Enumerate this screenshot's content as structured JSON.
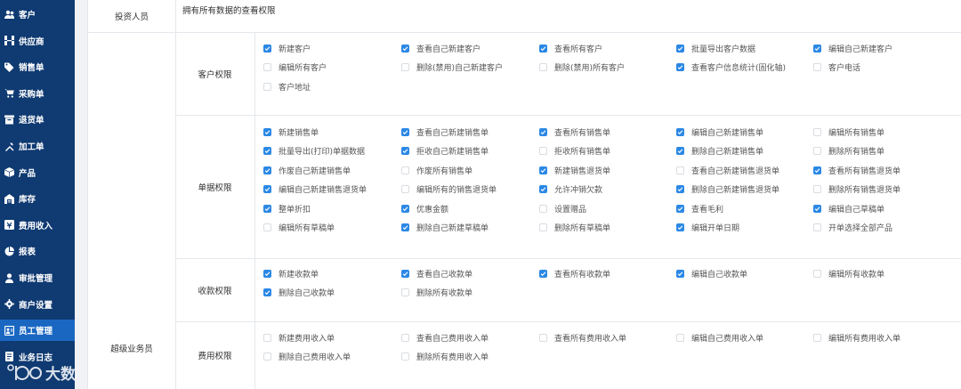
{
  "sidebar": {
    "items": [
      {
        "label": "客户",
        "icon": "users-icon",
        "active": false
      },
      {
        "label": "供应商",
        "icon": "supplier-icon",
        "active": false
      },
      {
        "label": "销售单",
        "icon": "tag-icon",
        "active": false
      },
      {
        "label": "采购单",
        "icon": "cart-icon",
        "active": false
      },
      {
        "label": "退货单",
        "icon": "return-icon",
        "active": false
      },
      {
        "label": "加工单",
        "icon": "tools-icon",
        "active": false
      },
      {
        "label": "产品",
        "icon": "box-icon",
        "active": false
      },
      {
        "label": "库存",
        "icon": "warehouse-icon",
        "active": false
      },
      {
        "label": "费用收入",
        "icon": "money-icon",
        "active": false
      },
      {
        "label": "报表",
        "icon": "chart-icon",
        "active": false
      },
      {
        "label": "审批管理",
        "icon": "approval-icon",
        "active": false
      },
      {
        "label": "商户设置",
        "icon": "gear-icon",
        "active": false
      },
      {
        "label": "员工管理",
        "icon": "staff-icon",
        "active": true
      },
      {
        "label": "业务日志",
        "icon": "log-icon",
        "active": false
      }
    ]
  },
  "watermark": {
    "text": "大数跨境"
  },
  "roles": {
    "investor": {
      "label": "投资人员",
      "description": "拥有所有数据的查看权限"
    },
    "super_staff": {
      "label": "超级业务员"
    }
  },
  "groups": [
    {
      "label": "客户权限",
      "rows": [
        [
          {
            "label": "新建客户",
            "checked": true
          },
          {
            "label": "查看自己新建客户",
            "checked": true
          },
          {
            "label": "查看所有客户",
            "checked": true
          },
          {
            "label": "批量导出客户数据",
            "checked": true
          },
          {
            "label": "编辑自己新建客户",
            "checked": true
          }
        ],
        [
          {
            "label": "编辑所有客户",
            "checked": false
          },
          {
            "label": "删除(禁用)自己新建客户",
            "checked": false
          },
          {
            "label": "删除(禁用)所有客户",
            "checked": false
          },
          {
            "label": "查看客户信息统计(固化轴)",
            "checked": true
          },
          {
            "label": "客户电话",
            "checked": false
          }
        ],
        [
          {
            "label": "客户地址",
            "checked": false
          }
        ]
      ]
    },
    {
      "label": "单据权限",
      "rows": [
        [
          {
            "label": "新建销售单",
            "checked": true
          },
          {
            "label": "查看自己新建销售单",
            "checked": true
          },
          {
            "label": "查看所有销售单",
            "checked": true
          },
          {
            "label": "编辑自己新建销售单",
            "checked": true
          },
          {
            "label": "编辑所有销售单",
            "checked": false
          }
        ],
        [
          {
            "label": "批量导出(打印)单据数据",
            "checked": true
          },
          {
            "label": "拒收自己新建销售单",
            "checked": true
          },
          {
            "label": "拒收所有销售单",
            "checked": false
          },
          {
            "label": "删除自己新建销售单",
            "checked": true
          },
          {
            "label": "删除所有销售单",
            "checked": false
          }
        ],
        [
          {
            "label": "作废自己新建销售单",
            "checked": true
          },
          {
            "label": "作废所有销售单",
            "checked": false
          },
          {
            "label": "新建销售退货单",
            "checked": true
          },
          {
            "label": "查看自己新建销售退货单",
            "checked": false
          },
          {
            "label": "查看所有销售退货单",
            "checked": true
          }
        ],
        [
          {
            "label": "编辑自己新建销售退货单",
            "checked": true
          },
          {
            "label": "编辑所有的销售退货单",
            "checked": false
          },
          {
            "label": "允许冲销欠款",
            "checked": true
          },
          {
            "label": "删除自己新建销售退货单",
            "checked": true
          },
          {
            "label": "删除所有销售退货单",
            "checked": false
          }
        ],
        [
          {
            "label": "整单折扣",
            "checked": true
          },
          {
            "label": "优惠金额",
            "checked": true
          },
          {
            "label": "设置赠品",
            "checked": false
          },
          {
            "label": "查看毛利",
            "checked": true
          },
          {
            "label": "编辑自己草稿单",
            "checked": true
          }
        ],
        [
          {
            "label": "编辑所有草稿单",
            "checked": false
          },
          {
            "label": "删除自己新建草稿单",
            "checked": true
          },
          {
            "label": "删除所有草稿单",
            "checked": false
          },
          {
            "label": "编辑开单日期",
            "checked": true
          },
          {
            "label": "开单选择全部产品",
            "checked": false
          }
        ]
      ]
    },
    {
      "label": "收款权限",
      "rows": [
        [
          {
            "label": "新建收款单",
            "checked": true
          },
          {
            "label": "查看自己收款单",
            "checked": true
          },
          {
            "label": "查看所有收款单",
            "checked": true
          },
          {
            "label": "编辑自己收款单",
            "checked": true
          },
          {
            "label": "编辑所有收款单",
            "checked": false
          }
        ],
        [
          {
            "label": "删除自己收款单",
            "checked": true
          },
          {
            "label": "删除所有收款单",
            "checked": false
          }
        ]
      ]
    },
    {
      "label": "费用权限",
      "rows": [
        [
          {
            "label": "新建费用收入单",
            "checked": false
          },
          {
            "label": "查看自己费用收入单",
            "checked": false
          },
          {
            "label": "查看所有费用收入单",
            "checked": false
          },
          {
            "label": "编辑自己费用收入单",
            "checked": false
          },
          {
            "label": "编辑所有费用收入单",
            "checked": false
          }
        ],
        [
          {
            "label": "删除自己费用收入单",
            "checked": false
          },
          {
            "label": "删除所有费用收入单",
            "checked": false
          }
        ]
      ]
    }
  ],
  "colors": {
    "sidebar": "#0f3a72",
    "active": "#1a67c2",
    "checkbox": "#2b88e5"
  }
}
